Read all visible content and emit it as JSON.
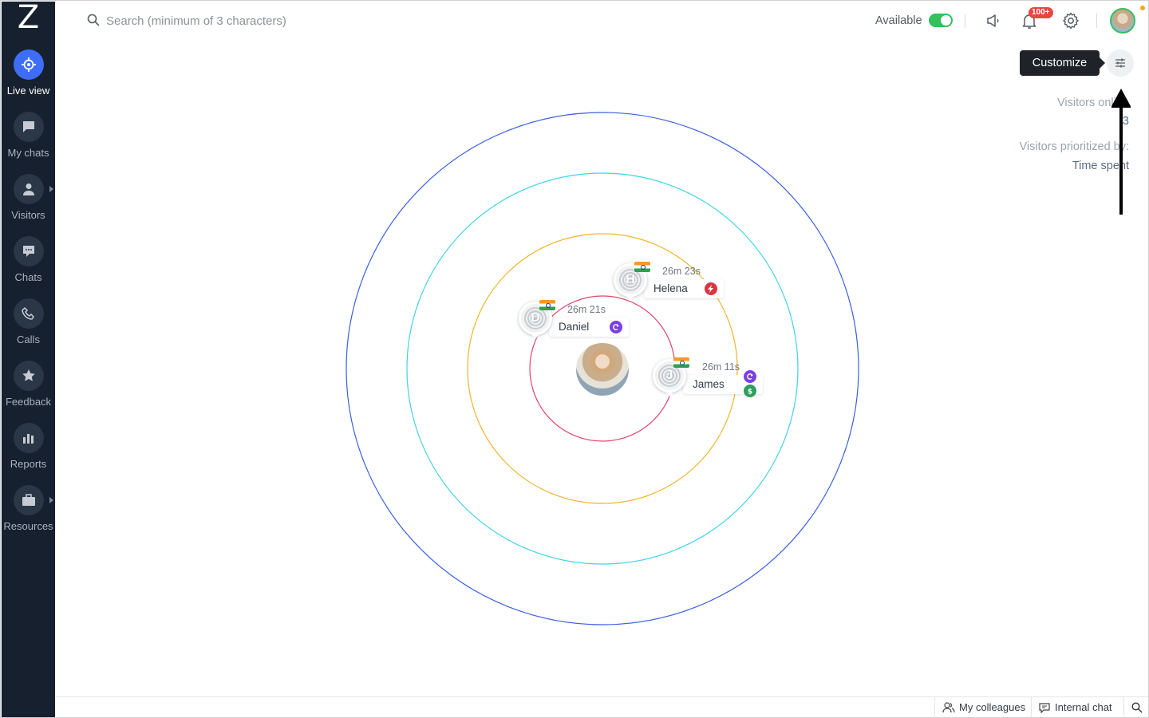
{
  "sidebar": {
    "logo": "Z",
    "items": [
      {
        "label": "Live view"
      },
      {
        "label": "My chats"
      },
      {
        "label": "Visitors"
      },
      {
        "label": "Chats"
      },
      {
        "label": "Calls"
      },
      {
        "label": "Feedback"
      },
      {
        "label": "Reports"
      },
      {
        "label": "Resources"
      }
    ]
  },
  "header": {
    "search_placeholder": "Search (minimum of 3 characters)",
    "status_label": "Available",
    "status_on": true,
    "notification_badge": "100+"
  },
  "customize": {
    "tooltip": "Customize"
  },
  "info": {
    "online_label": "Visitors online",
    "online_value": "3",
    "prioritized_label": "Visitors prioritized by:",
    "prioritized_value": "Time spent"
  },
  "visitors": [
    {
      "name": "Helena",
      "initial": "H",
      "time": "26m 23s",
      "status_icons": [
        "bolt-icon"
      ],
      "status_colors": [
        "#d9363e"
      ]
    },
    {
      "name": "Daniel",
      "initial": "D",
      "time": "26m 21s",
      "status_icons": [
        "refresh-icon"
      ],
      "status_colors": [
        "#7b3fe4"
      ]
    },
    {
      "name": "James",
      "initial": "J",
      "time": "26m 11s",
      "status_icons": [
        "refresh-icon",
        "dollar-icon"
      ],
      "status_colors": [
        "#7b3fe4",
        "#2e9e5e"
      ]
    }
  ],
  "orbit_colors": [
    "#e0466c",
    "#f0b429",
    "#3fd3e8",
    "#3b5fe0"
  ],
  "bottom_bar": {
    "colleagues": "My colleagues",
    "internal_chat": "Internal chat"
  },
  "colors": {
    "sidebar_bg": "#17202e",
    "accent": "#3d6ef5",
    "available": "#34c05a"
  }
}
